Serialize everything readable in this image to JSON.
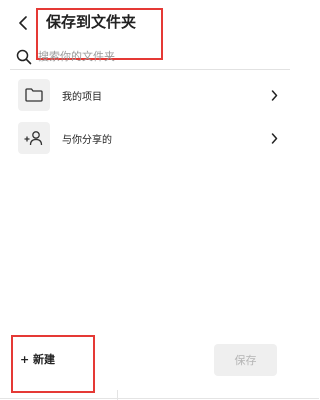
{
  "header": {
    "title": "保存到文件夹",
    "back_icon": "chevron-left-icon"
  },
  "search": {
    "placeholder": "搜索你的文件夹",
    "value": "",
    "icon": "search-icon"
  },
  "folders": [
    {
      "label": "我的项目",
      "icon": "folder-icon"
    },
    {
      "label": "与你分享的",
      "icon": "shared-users-icon"
    }
  ],
  "footer": {
    "new_label": "+ 新建",
    "save_label": "保存"
  },
  "colors": {
    "annotation": "#e53935",
    "save_disabled_bg": "#efefef",
    "save_disabled_text": "#b5b5b5"
  }
}
